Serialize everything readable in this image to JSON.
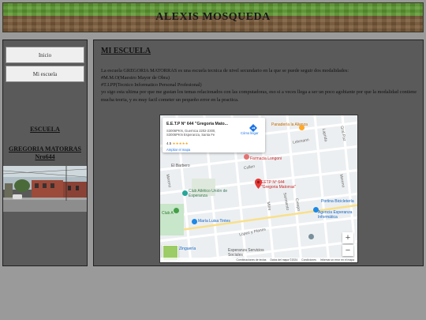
{
  "header": {
    "title": "ALEXIS MOSQUEDA"
  },
  "sidebar": {
    "nav": [
      "Inicio",
      "Mi escuela"
    ],
    "link_escuela": "ESCUELA",
    "link_school_line1": "GREGORIA MATORRAS",
    "link_school_line2": "Nro644"
  },
  "main": {
    "title": "MI ESCUELA",
    "paragraphs": [
      "La escuela GREGORIA MATORRAS es una escuela tecnica de nivel secundario en la que se puede seguir dos modalidades:",
      "#M.M.O(Maestro Mayor de Obra)",
      "#T.I.PP(Tecnico Informatico Personal Profesional)",
      "yo sigo esta ultima por que me gustan los temas relacionados con las computadoras, eso si a veces llega a ser un poco agobiante por que la modalidad contiene mucha teoria, y es muy facil cometer un pequeño error en la practica."
    ]
  },
  "map": {
    "card_name": "E.E.T.P N° 644 \"Gregoria Mato...",
    "card_addr_1": "S3006PKN, Guernica 2202-2300,",
    "card_addr_2": "S3006PKN Esperanza, Santa Fe",
    "rating": "4.5",
    "stars": "★★★★★",
    "bigger_map": "Ampliar el mapa",
    "directions": "Cómo llegar",
    "pin_label_1": "EETP N° 644",
    "pin_label_2": "\"Gregoria Matorras\"",
    "places": {
      "panaderia": "Panadería la Alianza",
      "farmacia": "Farmacia Longoni",
      "club": "Club Atlético Unión de Esperanza",
      "maria": "María Luisa Tintes",
      "esperanza": "Esperanza Servicios Sociales",
      "zinguera": "Zinguería",
      "agencia": "Agencia Esperanza Informática",
      "portina": "Portina Bicicletería",
      "barbero": "El Barbero",
      "club_amarillo": "Club A"
    },
    "streets": {
      "lehmann": "Lehmann",
      "cullen": "Cullen",
      "lopez": "López y Planes",
      "moreno": "Moreno",
      "guemes": "Güemes",
      "sarmiento": "Sarmiento",
      "crespo": "Crespo",
      "laprida": "Laprida",
      "gral_paz": "Gral Paz",
      "belgrano": "Belgrano",
      "mitre": "Mitre",
      "rivadavia": "Rivadavia"
    },
    "zoom_in": "+",
    "zoom_out": "−",
    "footer": [
      "Combinaciones de teclas",
      "Datos del mapa ©2024",
      "Condiciones",
      "Informar un error en el mapa"
    ]
  }
}
